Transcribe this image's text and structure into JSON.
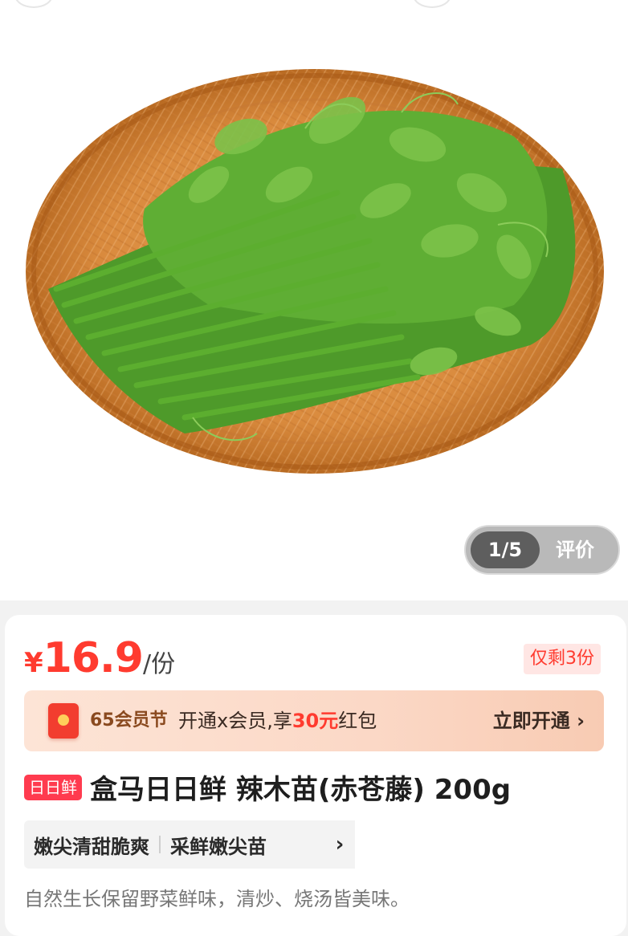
{
  "gallery": {
    "counter": "1/5",
    "review_label": "评价"
  },
  "product": {
    "currency": "¥",
    "price": "16.9",
    "unit": "/份",
    "stock_badge": "仅剩3份",
    "fresh_badge": "日日鲜",
    "title": "盒马日日鲜 辣木苗(赤苍藤) 200g",
    "tags": [
      "嫩尖清甜脆爽",
      "采鲜嫩尖苗"
    ],
    "description": "自然生长保留野菜鲜味，清炒、烧汤皆美味。"
  },
  "member_banner": {
    "festival": "65会员节",
    "promo_prefix": "开通x会员,享",
    "promo_amount": "30元",
    "promo_suffix": "红包",
    "cta": "立即开通 ›"
  },
  "colors": {
    "accent_red": "#ff3b2f",
    "banner_bg": "#fbd8c6",
    "banner_text": "#3a2a22"
  },
  "icons": {
    "member_icon": "red-packet-icon",
    "tags_more": "chevron-right-icon"
  }
}
